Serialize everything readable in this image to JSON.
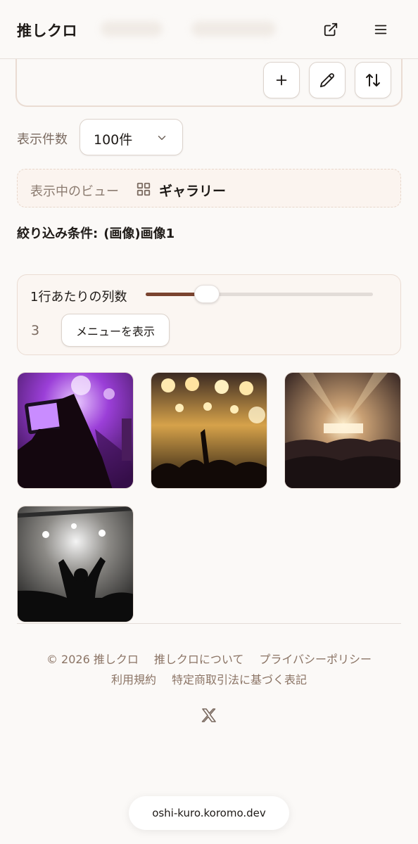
{
  "header": {
    "brand": "推しクロ",
    "external_link_icon": "external-link-icon",
    "menu_icon": "hamburger-menu-icon"
  },
  "toolbar": {
    "add_icon": "plus-icon",
    "edit_icon": "pencil-icon",
    "sort_icon": "sort-arrows-icon"
  },
  "display_count": {
    "label": "表示件数",
    "selected": "100件"
  },
  "current_view": {
    "label": "表示中のビュー",
    "icon": "grid-icon",
    "name": "ギャラリー"
  },
  "filter": {
    "label": "絞り込み条件:",
    "value": "(画像)画像1"
  },
  "columns": {
    "title": "1行あたりの列数",
    "value": "3",
    "slider_fraction": 0.27,
    "menu_button": "メニューを表示"
  },
  "gallery": {
    "images": [
      "concert-phone-photo",
      "concert-golden-lights",
      "concert-stage-crowd",
      "concert-silhouette"
    ]
  },
  "footer": {
    "copyright": "© 2026 推しクロ",
    "about": "推しクロについて",
    "privacy": "プライバシーポリシー",
    "terms": "利用規約",
    "tokushoho": "特定商取引法に基づく表記",
    "social_icon": "x-logo-icon"
  },
  "browser": {
    "url": "oshi-kuro.koromo.dev"
  },
  "colors": {
    "background": "#fbf9f7",
    "accent": "#7a4430",
    "muted_text": "#8b7465"
  }
}
